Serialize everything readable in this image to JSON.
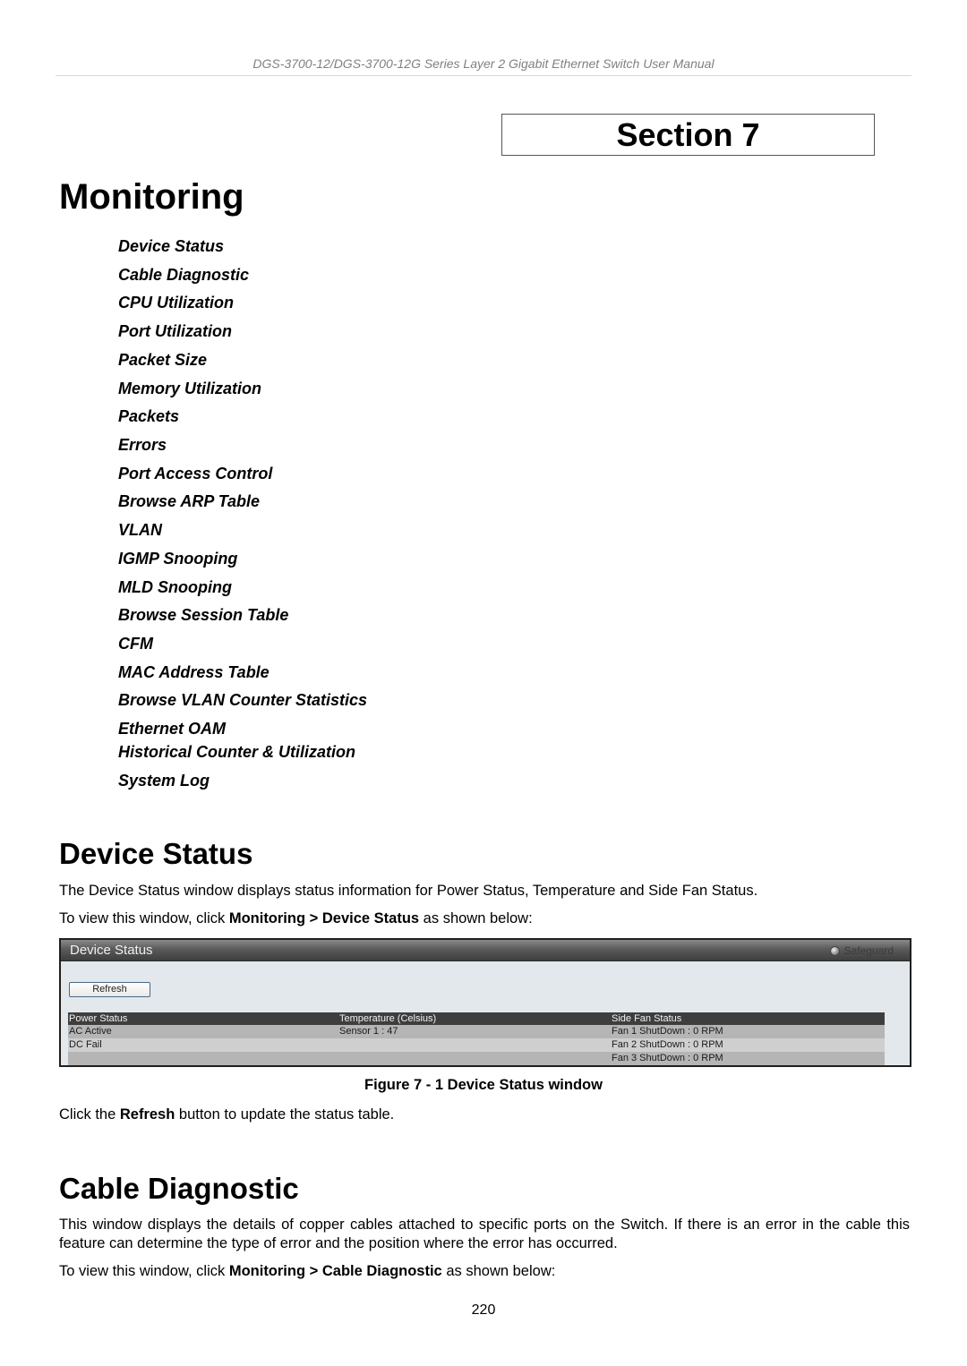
{
  "header": {
    "running_title": "DGS-3700-12/DGS-3700-12G Series Layer 2 Gigabit Ethernet Switch User Manual"
  },
  "section_label": "Section 7",
  "chapter_title": "Monitoring",
  "toc": [
    "Device Status",
    "Cable Diagnostic",
    "CPU Utilization",
    "Port Utilization",
    "Packet Size",
    "Memory Utilization",
    "Packets",
    "Errors",
    "Port Access Control",
    "Browse ARP Table",
    "VLAN",
    "IGMP Snooping",
    "MLD Snooping",
    "Browse Session Table",
    "CFM",
    "MAC Address Table",
    "Browse VLAN Counter Statistics",
    "Ethernet OAM",
    "Historical Counter & Utilization",
    "System Log"
  ],
  "device_status": {
    "heading": "Device Status",
    "intro": "The Device Status window displays status information for Power Status, Temperature and Side Fan Status.",
    "nav_prefix": "To view this window, click ",
    "nav_menu": "Monitoring",
    "nav_sep": " > ",
    "nav_item": "Device Status",
    "nav_suffix": " as shown below:",
    "window": {
      "title": "Device Status",
      "safeguard_label": "Safeguard",
      "refresh_label": "Refresh",
      "columns": [
        "Power Status",
        "Temperature (Celsius)",
        "Side Fan Status"
      ],
      "rows": [
        [
          "AC  Active",
          "Sensor 1 : 47",
          "Fan 1 ShutDown : 0 RPM"
        ],
        [
          "DC  Fail",
          "",
          "Fan 2 ShutDown : 0 RPM"
        ],
        [
          "",
          "",
          "Fan 3 ShutDown : 0 RPM"
        ]
      ]
    },
    "figure_caption": "Figure 7 - 1 Device Status window",
    "after_prefix": "Click the ",
    "after_bold": "Refresh",
    "after_suffix": " button to update the status table."
  },
  "cable_diagnostic": {
    "heading": "Cable Diagnostic",
    "intro": "This window displays the details of copper cables attached to specific ports on the Switch. If there is an error in the cable this feature can determine the type of error and the position where the error has occurred.",
    "nav_prefix": "To view this window, click ",
    "nav_menu": "Monitoring",
    "nav_sep": " > ",
    "nav_item": "Cable Diagnostic",
    "nav_suffix": " as shown below:"
  },
  "page_number": "220"
}
